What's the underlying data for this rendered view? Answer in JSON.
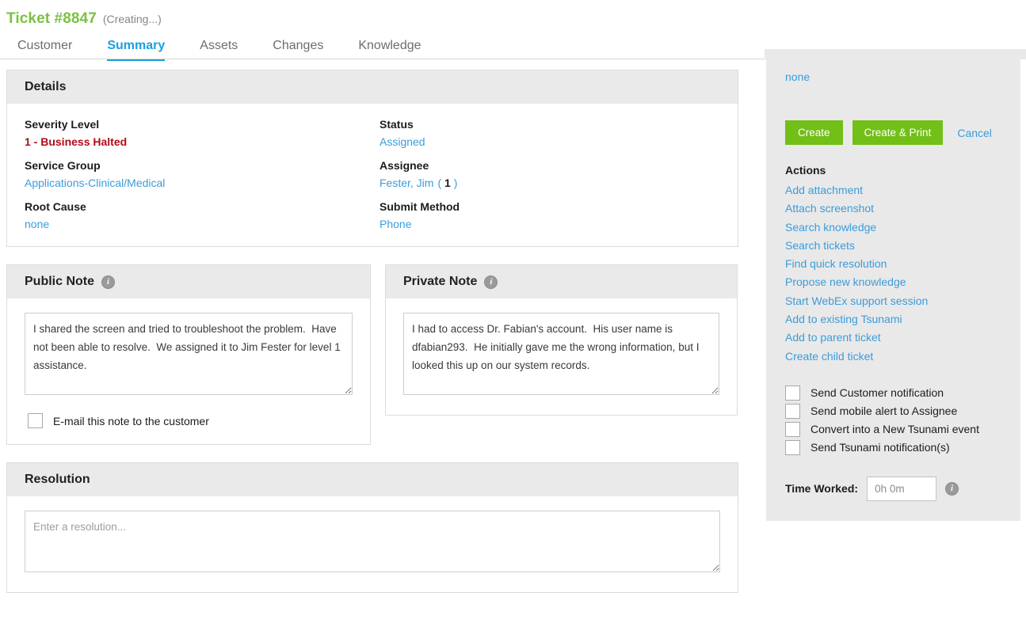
{
  "header": {
    "ticket_title": "Ticket #8847",
    "ticket_state": "(Creating...)",
    "tabs": [
      {
        "label": "Customer",
        "active": false
      },
      {
        "label": "Summary",
        "active": true
      },
      {
        "label": "Assets",
        "active": false
      },
      {
        "label": "Changes",
        "active": false
      },
      {
        "label": "Knowledge",
        "active": false
      }
    ]
  },
  "details": {
    "heading": "Details",
    "fields": [
      {
        "label": "Severity Level",
        "value": "1 - Business Halted"
      },
      {
        "label": "Status",
        "value": "Assigned"
      },
      {
        "label": "Service Group",
        "value": "Applications-Clinical/Medical"
      },
      {
        "label": "Assignee",
        "value": "Fester, Jim",
        "count": "1"
      },
      {
        "label": "Root Cause",
        "value": "none"
      },
      {
        "label": "Submit Method",
        "value": "Phone"
      }
    ]
  },
  "public_note": {
    "heading": "Public Note",
    "info_icon": "info-icon",
    "text": "I shared the screen and tried to troubleshoot the problem.  Have not been able to resolve.  We assigned it to Jim Fester for level 1 assistance.",
    "placeholder": "",
    "checkbox_label": "E-mail this note to the customer",
    "checkbox_checked": false
  },
  "private_note": {
    "heading": "Private Note",
    "info_icon": "info-icon",
    "text": "I had to access Dr. Fabian's account.  His user name is dfabian293.  He initially gave me the wrong information, but I looked this up on our system records.",
    "placeholder": ""
  },
  "resolution": {
    "heading": "Resolution",
    "text": "",
    "placeholder": "Enter a resolution..."
  },
  "sidebar": {
    "none_label": "none",
    "buttons": {
      "create": "Create",
      "create_print": "Create & Print",
      "cancel": "Cancel"
    },
    "accent_green": "#72bf18",
    "link_blue": "#3b9cd9",
    "actions_title": "Actions",
    "actions": [
      "Add attachment",
      "Attach screenshot",
      "Search knowledge",
      "Search tickets",
      "Find quick resolution",
      "Propose new knowledge",
      "Start WebEx support session",
      "Add to existing Tsunami",
      "Add to parent ticket",
      "Create child ticket"
    ],
    "checkboxes": [
      {
        "label": "Send Customer notification",
        "checked": false
      },
      {
        "label": "Send mobile alert to Assignee",
        "checked": false
      },
      {
        "label": "Convert into a New Tsunami event",
        "checked": false
      },
      {
        "label": "Send Tsunami notification(s)",
        "checked": false
      }
    ],
    "time_worked": {
      "label": "Time Worked:",
      "value": "",
      "placeholder": "0h 0m",
      "info_icon": "info-icon"
    }
  }
}
